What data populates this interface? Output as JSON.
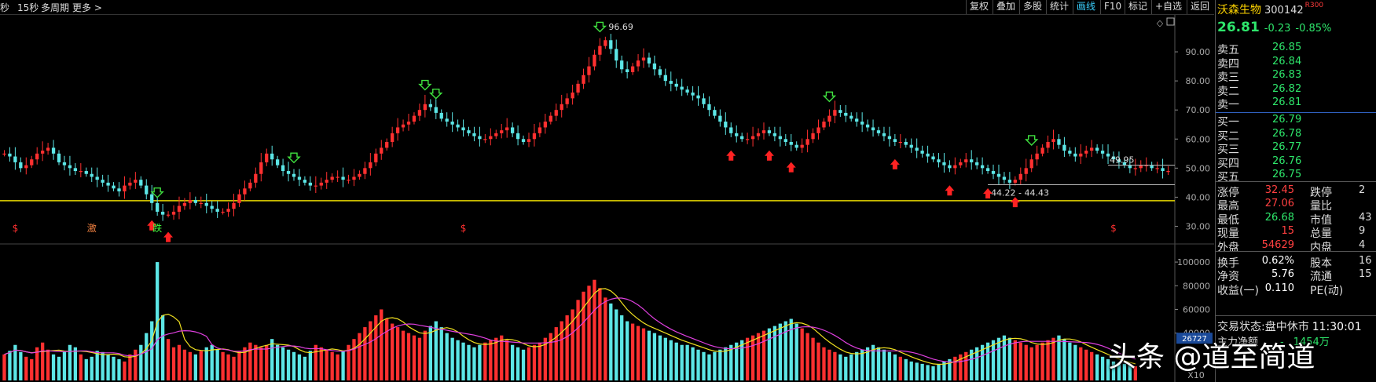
{
  "toolbar": {
    "left_items": [
      "秒",
      "15秒",
      "多周期",
      "更多 >"
    ],
    "right_items": [
      "复权",
      "叠加",
      "多股",
      "统计",
      "画线",
      "F10",
      "标记",
      "+自选",
      "返回"
    ],
    "active_item": "画线"
  },
  "quote": {
    "name": "沃森生物",
    "code": "300142",
    "index_tag": "R300",
    "price": "26.81",
    "change": "-0.23",
    "change_pct": "-0.85%",
    "edge_clip": "-0.",
    "asks": [
      {
        "label": "卖五",
        "price": "26.85"
      },
      {
        "label": "卖四",
        "price": "26.84"
      },
      {
        "label": "卖三",
        "price": "26.83"
      },
      {
        "label": "卖二",
        "price": "26.82"
      },
      {
        "label": "卖一",
        "price": "26.81"
      }
    ],
    "bids": [
      {
        "label": "买一",
        "price": "26.79"
      },
      {
        "label": "买二",
        "price": "26.78"
      },
      {
        "label": "买三",
        "price": "26.77"
      },
      {
        "label": "买四",
        "price": "26.76"
      },
      {
        "label": "买五",
        "price": "26.75"
      }
    ],
    "stats": [
      {
        "l1": "涨停",
        "v1": "32.45",
        "c1": "red",
        "l2": "跌停",
        "v2": "2"
      },
      {
        "l1": "最高",
        "v1": "27.06",
        "c1": "red",
        "l2": "量比",
        "v2": ""
      },
      {
        "l1": "最低",
        "v1": "26.68",
        "c1": "green",
        "l2": "市值",
        "v2": "43"
      },
      {
        "l1": "现量",
        "v1": "15",
        "c1": "red",
        "l2": "总量",
        "v2": "9"
      },
      {
        "l1": "外盘",
        "v1": "54629",
        "c1": "red",
        "l2": "内盘",
        "v2": "4"
      },
      {
        "l1": "换手",
        "v1": "0.62%",
        "c1": "white",
        "l2": "股本",
        "v2": "16"
      },
      {
        "l1": "净资",
        "v1": "5.76",
        "c1": "white",
        "l2": "流通",
        "v2": "15"
      },
      {
        "l1": "收益(一)",
        "v1": "0.110",
        "c1": "white",
        "l2": "PE(动)",
        "v2": ""
      }
    ],
    "trade_status_label": "交易状态:",
    "trade_status": "盘中休市",
    "trade_time": "11:30:01",
    "main_fund_label": "主力净额",
    "main_fund_value": "-",
    "main_fund_unit": "1454万",
    "bottom_prices": [
      "26.79",
      "26.78"
    ]
  },
  "watermark": "头条 @道至简道",
  "colors": {
    "up": "#ff3030",
    "down": "#5ce6e6",
    "ma5": "#f0e020",
    "ma10": "#e040e0",
    "support": "#e8d800"
  },
  "chart_data": [
    {
      "type": "candlestick",
      "title": "",
      "ylim": [
        25,
        100
      ],
      "y_ticks": [
        "90.00",
        "80.00",
        "70.00",
        "60.00",
        "50.00",
        "40.00",
        "30.00"
      ],
      "y_tick_values": [
        90,
        80,
        70,
        60,
        50,
        40,
        30
      ],
      "annotations": {
        "max": "96.69",
        "last_label": "49.95",
        "support_label": "44.22 - 44.43",
        "support_level": 38.8
      },
      "markers": [
        {
          "idx": 2,
          "text": "$"
        },
        {
          "idx": 16,
          "text": "激"
        },
        {
          "idx": 28,
          "text": "跌"
        },
        {
          "idx": 84,
          "text": "$"
        },
        {
          "idx": 203,
          "text": "$"
        }
      ],
      "down_arrows_idx": [
        28,
        53,
        77,
        79,
        109,
        151,
        188
      ],
      "up_arrows_idx": [
        27,
        30,
        133,
        140,
        144,
        163,
        173,
        180,
        185
      ],
      "closes": [
        55,
        54,
        52,
        50,
        51,
        53,
        55,
        56,
        57,
        55,
        52,
        51,
        50,
        49,
        49,
        48,
        47,
        46,
        45,
        44,
        43,
        42,
        44,
        45,
        46,
        44,
        41,
        38,
        35,
        34,
        34,
        35,
        37,
        38,
        39,
        38,
        38,
        37,
        36,
        35,
        35,
        36,
        38,
        41,
        43,
        45,
        48,
        52,
        55,
        53,
        51,
        49,
        48,
        47,
        46,
        45,
        44,
        44,
        45,
        46,
        47,
        47,
        46,
        46,
        47,
        48,
        50,
        52,
        55,
        57,
        59,
        62,
        64,
        65,
        66,
        68,
        70,
        72,
        71,
        69,
        67,
        66,
        65,
        64,
        63,
        62,
        61,
        60,
        60,
        61,
        62,
        63,
        64,
        62,
        60,
        59,
        60,
        62,
        64,
        66,
        68,
        70,
        72,
        74,
        76,
        79,
        82,
        85,
        89,
        92,
        94,
        91,
        87,
        84,
        83,
        85,
        87,
        88,
        86,
        84,
        82,
        80,
        79,
        78,
        77,
        76,
        75,
        74,
        72,
        70,
        68,
        66,
        64,
        62,
        61,
        60,
        60,
        61,
        62,
        63,
        62,
        61,
        60,
        59,
        58,
        57,
        58,
        60,
        62,
        64,
        66,
        68,
        70,
        69,
        68,
        67,
        66,
        65,
        64,
        63,
        62,
        61,
        60,
        59,
        59,
        58,
        57,
        56,
        55,
        54,
        53,
        52,
        51,
        50,
        51,
        52,
        53,
        52,
        51,
        50,
        49,
        48,
        47,
        46,
        45,
        46,
        48,
        50,
        53,
        55,
        57,
        59,
        60,
        58,
        56,
        55,
        54,
        55,
        56,
        57,
        56,
        55,
        54,
        53,
        52,
        51,
        50,
        50,
        51,
        51,
        50,
        50,
        49,
        49
      ],
      "volume": {
        "ylim": [
          0,
          110000
        ],
        "y_ticks": [
          "100000",
          "80000",
          "60000",
          "40000"
        ],
        "y_tick_values": [
          100000,
          80000,
          60000,
          40000
        ],
        "current_label": "26727",
        "unit_label": "X10",
        "values": [
          22,
          25,
          30,
          24,
          20,
          18,
          28,
          32,
          26,
          22,
          20,
          24,
          30,
          28,
          22,
          18,
          20,
          25,
          24,
          22,
          20,
          18,
          16,
          22,
          26,
          30,
          40,
          50,
          100,
          55,
          35,
          28,
          30,
          26,
          24,
          22,
          25,
          28,
          30,
          26,
          24,
          22,
          20,
          25,
          28,
          32,
          30,
          28,
          30,
          35,
          30,
          28,
          26,
          24,
          22,
          20,
          25,
          30,
          28,
          26,
          24,
          22,
          25,
          30,
          35,
          40,
          45,
          50,
          55,
          60,
          52,
          48,
          45,
          42,
          40,
          38,
          36,
          42,
          46,
          50,
          45,
          40,
          36,
          34,
          32,
          30,
          28,
          30,
          32,
          34,
          36,
          38,
          34,
          30,
          28,
          26,
          28,
          30,
          32,
          36,
          40,
          45,
          50,
          55,
          60,
          68,
          75,
          80,
          85,
          78,
          70,
          65,
          60,
          55,
          50,
          48,
          46,
          44,
          42,
          40,
          38,
          36,
          34,
          32,
          30,
          30,
          28,
          26,
          24,
          22,
          24,
          26,
          28,
          30,
          32,
          34,
          36,
          38,
          40,
          42,
          44,
          46,
          48,
          50,
          52,
          48,
          44,
          40,
          36,
          32,
          28,
          26,
          24,
          22,
          20,
          22,
          24,
          26,
          28,
          30,
          28,
          26,
          24,
          22,
          20,
          18,
          16,
          15,
          14,
          13,
          12,
          14,
          16,
          18,
          20,
          22,
          24,
          26,
          28,
          30,
          32,
          34,
          36,
          38,
          36,
          34,
          32,
          30,
          28,
          30,
          32,
          34,
          36,
          38,
          35,
          32,
          30,
          28,
          26,
          24,
          22,
          20,
          18,
          16,
          15,
          14,
          13,
          12
        ]
      }
    }
  ]
}
